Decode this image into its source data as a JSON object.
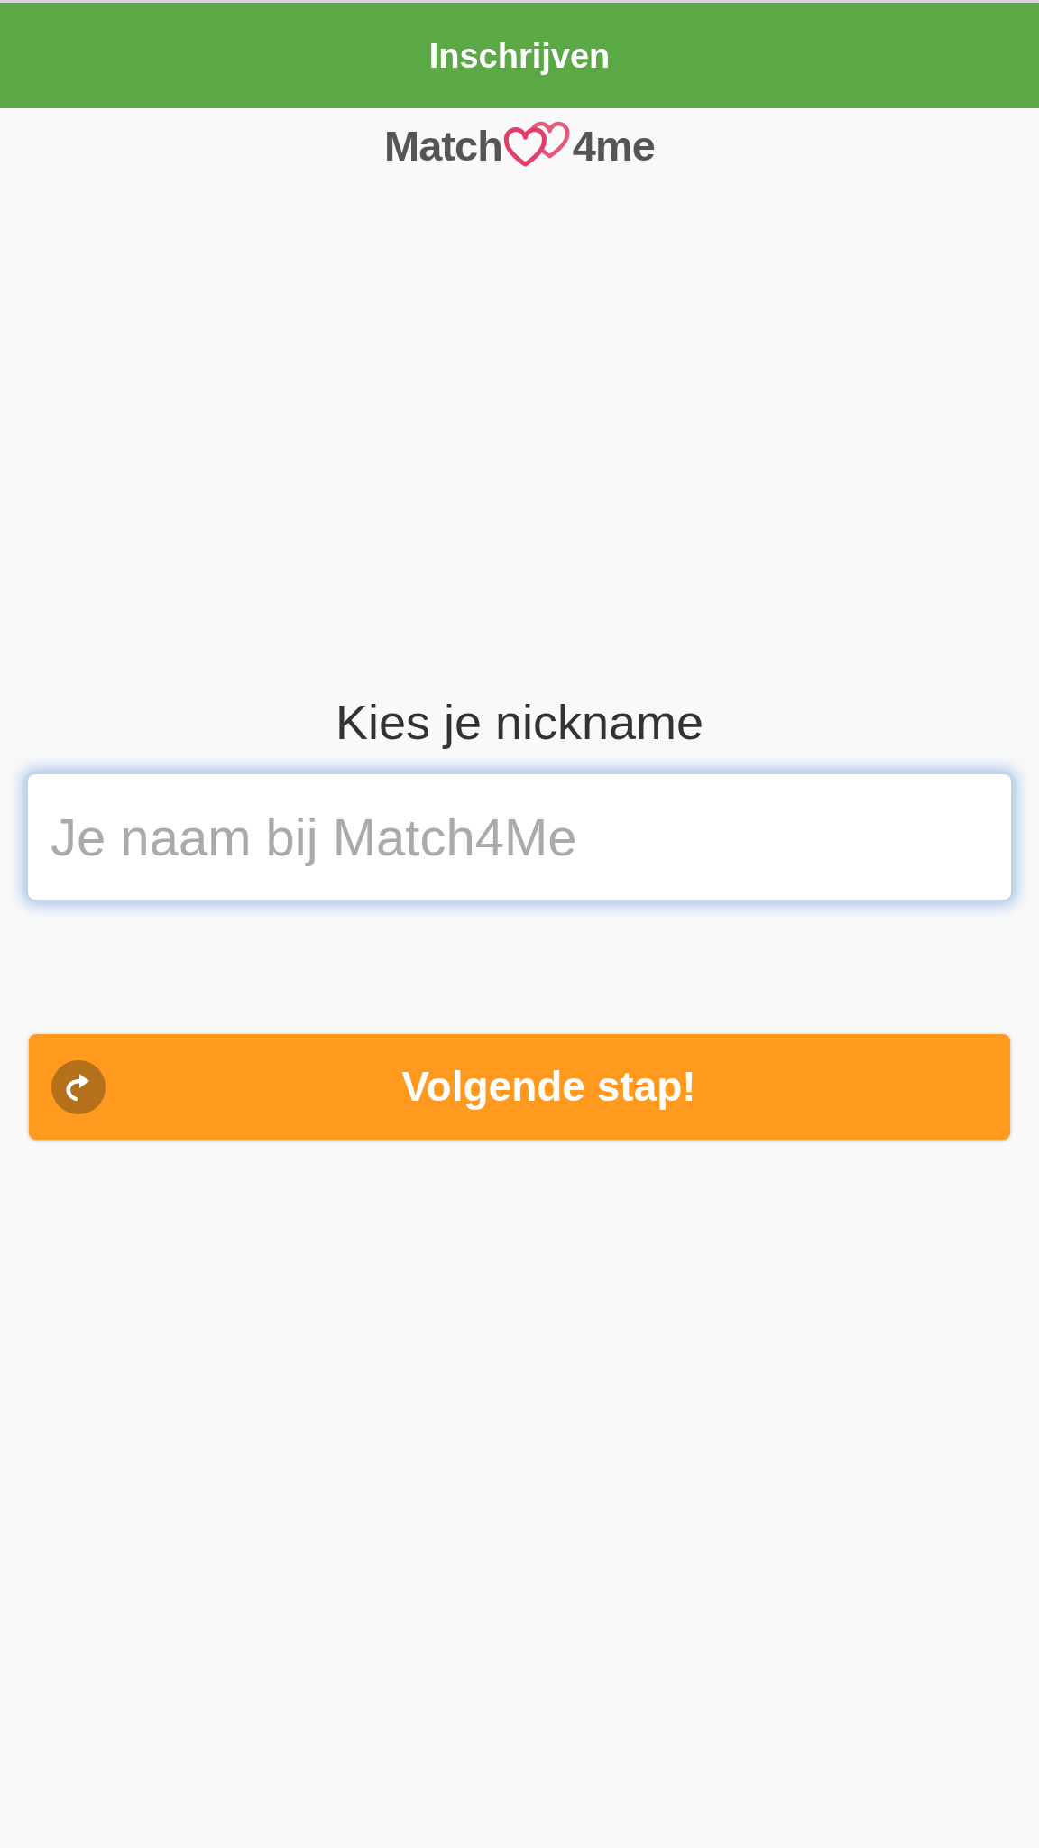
{
  "header": {
    "title": "Inschrijven"
  },
  "logo": {
    "text_before": "Match",
    "text_after": "4me"
  },
  "form": {
    "label": "Kies je nickname",
    "nickname_field": {
      "placeholder": "Je naam bij Match4Me",
      "focused": true
    }
  },
  "next_button": {
    "label": "Volgende stap!"
  }
}
